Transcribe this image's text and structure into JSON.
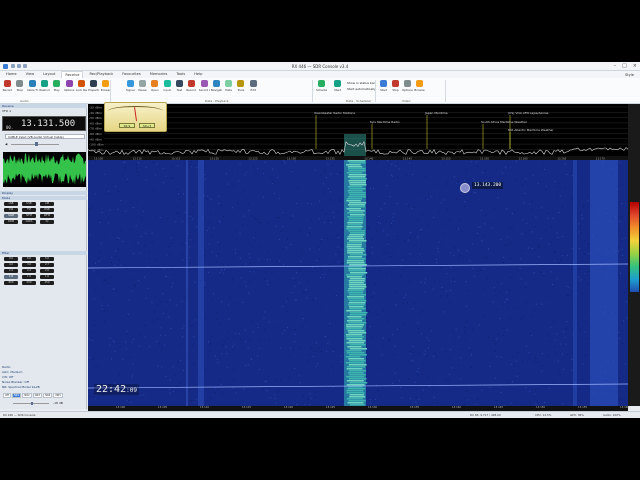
{
  "window": {
    "title": "RX 446 — SDR Console v3.4"
  },
  "menu": {
    "tabs": [
      "Home",
      "View",
      "Layout",
      "Receive",
      "Rec/Playback",
      "Favourites",
      "Memories",
      "Tools",
      "Help"
    ],
    "active_index": 3,
    "style_label": "Style"
  },
  "ribbon": {
    "buttons": [
      "Record",
      "Stop",
      "Cable Transfer",
      "Rewind",
      "Play",
      "Options",
      "Lock Radio",
      "Properties",
      "Browse",
      "Signal",
      "Pause",
      "Open",
      "Input",
      "Test",
      "Record FM",
      "Record Audio",
      "Navigation",
      "Data",
      "Tools",
      "Edit"
    ],
    "scheduler_buttons": [
      "Scheduler",
      "Start"
    ],
    "scheduler_notes": [
      "Show in status bar",
      "Start automatically"
    ],
    "video_buttons": [
      "Start",
      "Stop",
      "Options",
      "Browse"
    ],
    "groups": [
      "Audio",
      "Data - Playback",
      "Data - Playback",
      "Data - Scheduler",
      "Video"
    ]
  },
  "meter": {
    "box_left": "S9 9",
    "box_right": "S9+3"
  },
  "left_panel": {
    "radio_header": "Receive",
    "vfo_label": "VFO 1",
    "frequency": "13.131.500",
    "freq_prefix": "00.",
    "device": "CABLE Input (VB-Audio Virtual Cable)",
    "display_header": "Display",
    "mode_header": "Mode",
    "mode_buttons": [
      "LSB",
      "USB",
      "AM",
      "CW",
      "FM",
      "DSB",
      "SAM",
      "NFM",
      "WFM",
      "DRM",
      "DATA",
      "IQ"
    ],
    "selected_mode_index": 6,
    "filter_header": "Filter",
    "filter_buttons": [
      "9.0",
      "6.0",
      "5.0",
      "4.0",
      "3.0",
      "2.7",
      "2.4",
      "2.2",
      "2.0",
      "1.8",
      "1.5",
      "1.0",
      "800",
      "500",
      "250"
    ],
    "selected_filter_index": 9,
    "rows": [
      "Radio",
      "AGC: Medium",
      "CW: Off",
      "Noise Blanker: Off",
      "NR: Spectral Model 1&2B"
    ],
    "modes_row": [
      "Off",
      "NR1",
      "NR2",
      "NR3",
      "NR4",
      "NR5"
    ],
    "selected_modes_row_index": 1,
    "squelch_level": "-18 dB",
    "bottom_rows": [
      "Squelch: Off",
      "Squelch: Off"
    ]
  },
  "spectrum": {
    "y_labels": [
      "-30 dBm",
      "-40 dBm",
      "-50 dBm",
      "-60 dBm",
      "-70 dBm",
      "-80 dBm",
      "-90 dBm",
      "-100 dBm",
      "-110 dBm"
    ],
    "station_labels": [
      "Ulaanbaatar Radio Stations",
      "Kyiv Maritime Radio",
      "Japan Maritime",
      "(US) VOA AFN Lajes/Azores",
      "South Africa Maritime Weather",
      "Mid-Atlantic Maritime Weather"
    ],
    "freq_ticks": [
      "13.100",
      "13.110",
      "13.115",
      "13.120",
      "13.125",
      "13.130",
      "13.135",
      "13.140",
      "13.145",
      "13.150",
      "13.155",
      "13.160",
      "13.165",
      "13.170"
    ]
  },
  "waterfall": {
    "clock": "22:42",
    "clock_seconds": ":09",
    "cursor_freq": "13.143.200",
    "time_ticks": [
      "13.100",
      "13.105",
      "13.110",
      "13.115",
      "13.120",
      "13.125",
      "13.130",
      "13.135",
      "13.140",
      "13.145",
      "13.150",
      "13.155",
      "13.160"
    ]
  },
  "status": {
    "left": "RX 446 — SDR Console",
    "right": [
      "RX 1B, 9.717 / 448.00",
      "CPU: 14.5%",
      "GPU: 36%",
      "Audio: 100%"
    ]
  },
  "colors": {
    "waterfall_bg": "#142a86",
    "signal": "#48c6b1",
    "accent": "#3a7bd5"
  }
}
